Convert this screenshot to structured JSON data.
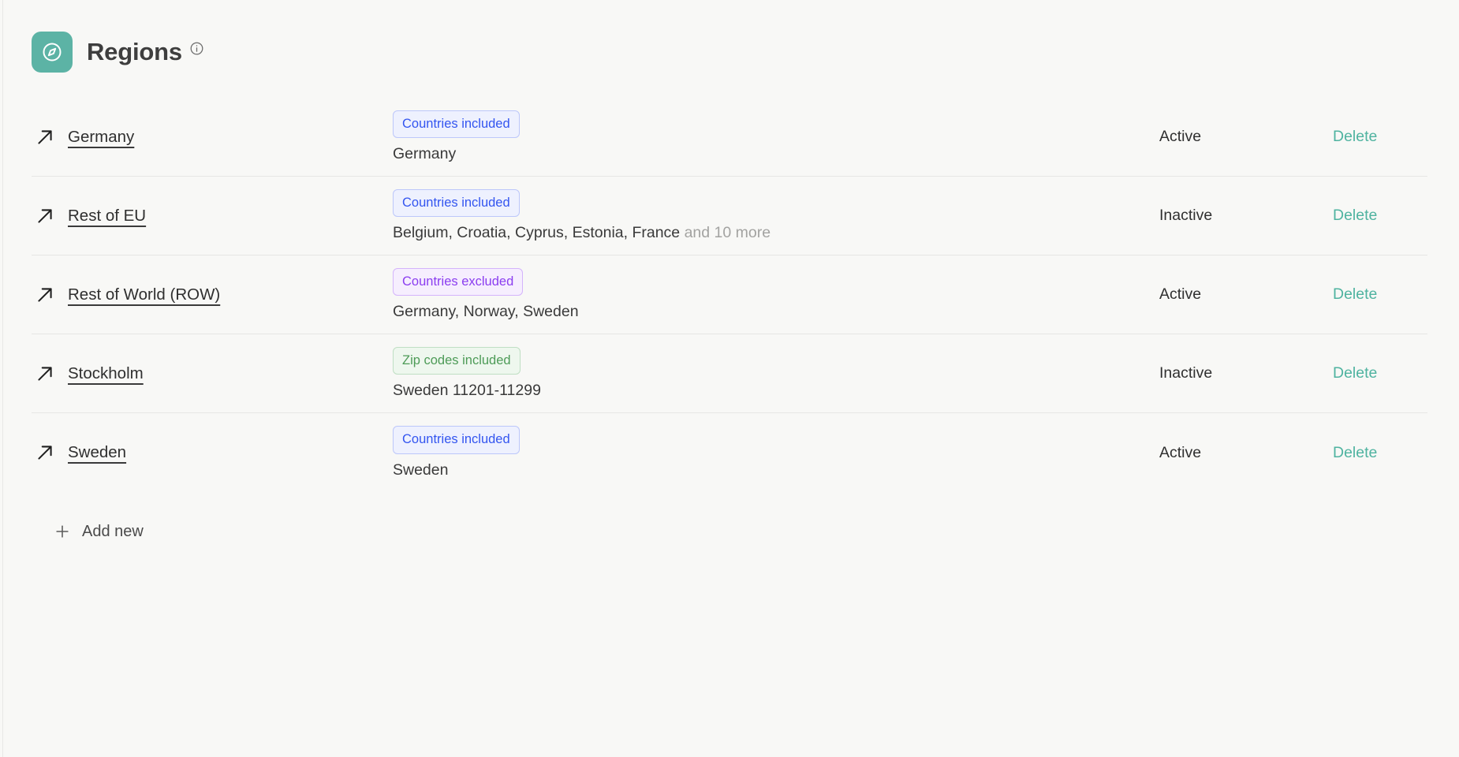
{
  "header": {
    "title": "Regions",
    "app_icon": "compass-icon",
    "info_icon": "info-circle-icon",
    "accent_color": "#5cb3a5"
  },
  "colors": {
    "background": "#f8f8f6",
    "divider": "#e6e6e4",
    "badge_blue": "#3355f0",
    "badge_purple": "#8b3df0",
    "badge_green": "#4d9b57",
    "delete_link": "#4fb3a0",
    "muted_text": "#a3a3a1"
  },
  "rows": [
    {
      "name": "Germany",
      "link_icon": "arrow-up-right-icon",
      "badge": {
        "label": "Countries included",
        "variant": "blue"
      },
      "detail": "Germany",
      "detail_more": "",
      "status": "Active",
      "action": "Delete"
    },
    {
      "name": "Rest of EU",
      "link_icon": "arrow-up-right-icon",
      "badge": {
        "label": "Countries included",
        "variant": "blue"
      },
      "detail": "Belgium, Croatia, Cyprus, Estonia, France",
      "detail_more": "and 10 more",
      "status": "Inactive",
      "action": "Delete"
    },
    {
      "name": "Rest of World (ROW)",
      "link_icon": "arrow-up-right-icon",
      "badge": {
        "label": "Countries excluded",
        "variant": "purple"
      },
      "detail": "Germany, Norway, Sweden",
      "detail_more": "",
      "status": "Active",
      "action": "Delete"
    },
    {
      "name": "Stockholm",
      "link_icon": "arrow-up-right-icon",
      "badge": {
        "label": "Zip codes included",
        "variant": "green"
      },
      "detail": "Sweden 11201-11299",
      "detail_more": "",
      "status": "Inactive",
      "action": "Delete"
    },
    {
      "name": "Sweden",
      "link_icon": "arrow-up-right-icon",
      "badge": {
        "label": "Countries included",
        "variant": "blue"
      },
      "detail": "Sweden",
      "detail_more": "",
      "status": "Active",
      "action": "Delete"
    }
  ],
  "add_new": {
    "label": "Add new",
    "icon": "plus-icon"
  }
}
